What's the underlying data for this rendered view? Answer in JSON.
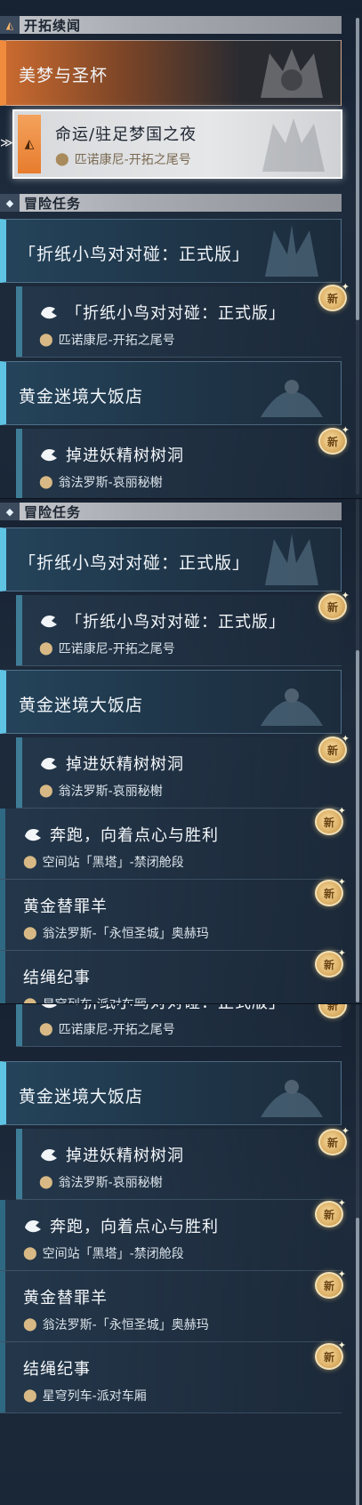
{
  "colors": {
    "accent_blue": "#5fc3e3",
    "accent_orange": "#f08a3d",
    "new_badge_gold": "#e0b56c",
    "header_bg": "#a8acb2"
  },
  "panel1": {
    "section_trailblaze": {
      "icon": "trailblaze-icon",
      "title": "开拓续闻"
    },
    "category_dreams": {
      "title": "美梦与圣杯"
    },
    "selected_quest": {
      "title": "命运/驻足梦国之夜",
      "location": "匹诺康尼-开拓之尾号"
    },
    "section_adventure": {
      "icon": "adventure-icon",
      "title": "冒险任务"
    },
    "category_origami": {
      "title": "「折纸小鸟对对碰：正式版」"
    },
    "quest_origami": {
      "title": "「折纸小鸟对对碰：正式版」",
      "location": "匹诺康尼-开拓之尾号",
      "badge": "新"
    },
    "category_hotel": {
      "title": "黄金迷境大饭店"
    },
    "quest_fairy": {
      "title": "掉进妖精树树洞",
      "location": "翁法罗斯-哀丽秘榭",
      "badge": "新"
    }
  },
  "panel2": {
    "section_adventure": {
      "icon": "adventure-icon",
      "title": "冒险任务"
    },
    "category_origami": {
      "title": "「折纸小鸟对对碰：正式版」"
    },
    "quest_origami": {
      "title": "「折纸小鸟对对碰：正式版」",
      "location": "匹诺康尼-开拓之尾号",
      "badge": "新"
    },
    "category_hotel": {
      "title": "黄金迷境大饭店"
    },
    "quest_fairy": {
      "title": "掉进妖精树树洞",
      "location": "翁法罗斯-哀丽秘榭",
      "badge": "新"
    },
    "quest_run": {
      "title": "奔跑，向着点心与胜利",
      "location": "空间站「黑塔」-禁闭舱段",
      "badge": "新"
    },
    "quest_scapegoat": {
      "title": "黄金替罪羊",
      "location": "翁法罗斯-「永恒圣城」奥赫玛",
      "badge": "新"
    },
    "quest_knot": {
      "title": "结绳纪事",
      "location": "星穹列车-派对车厢",
      "badge": "新"
    }
  },
  "panel3": {
    "quest_origami": {
      "title": "「折纸小鸟对对碰：正式版」",
      "location": "匹诺康尼-开拓之尾号",
      "badge": "新"
    },
    "category_hotel": {
      "title": "黄金迷境大饭店"
    },
    "quest_fairy": {
      "title": "掉进妖精树树洞",
      "location": "翁法罗斯-哀丽秘榭",
      "badge": "新"
    },
    "quest_run": {
      "title": "奔跑，向着点心与胜利",
      "location": "空间站「黑塔」-禁闭舱段",
      "badge": "新"
    },
    "quest_scapegoat": {
      "title": "黄金替罪羊",
      "location": "翁法罗斯-「永恒圣城」奥赫玛",
      "badge": "新"
    },
    "quest_knot": {
      "title": "结绳纪事",
      "location": "星穹列车-派对车厢",
      "badge": "新"
    }
  }
}
